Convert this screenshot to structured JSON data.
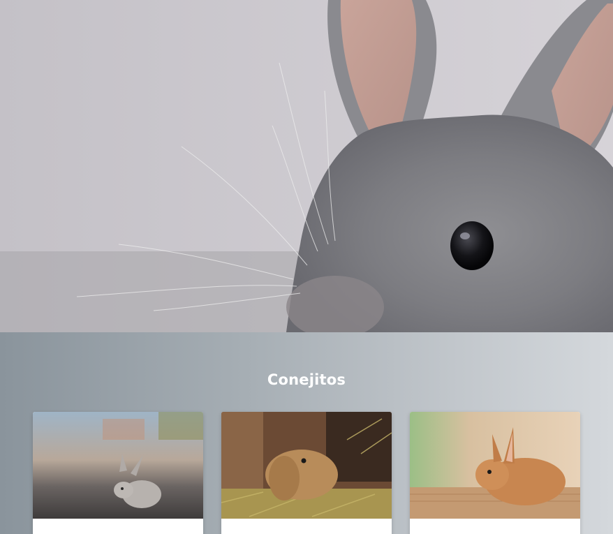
{
  "section": {
    "title": "Conejitos"
  },
  "cards": [
    {
      "image": "rabbit-on-road-photo"
    },
    {
      "image": "rabbit-in-straw-photo"
    },
    {
      "image": "rabbit-on-mat-photo"
    }
  ]
}
